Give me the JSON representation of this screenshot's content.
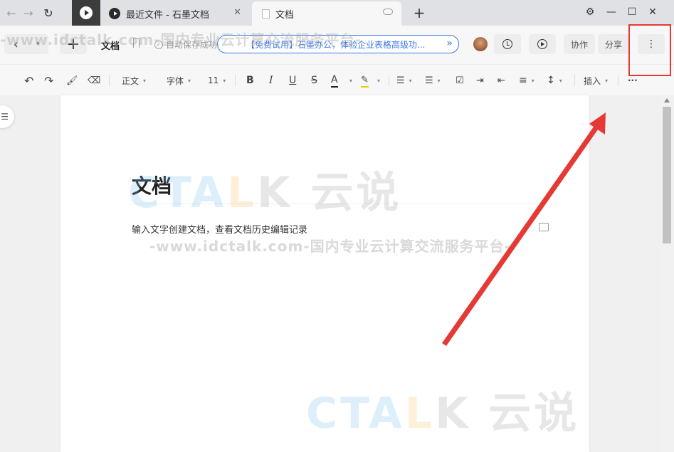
{
  "tabs": [
    {
      "label": "最近文件 - 石墨文档",
      "close": "✕"
    },
    {
      "label": "文档"
    }
  ],
  "window": {
    "settings_icon": "⚙",
    "minimize": "—",
    "maximize": "☐",
    "close": "✕",
    "new_tab": "+"
  },
  "toolbar": {
    "back": "‹",
    "back_menu": "▾",
    "new": "+",
    "doc_title": "文档",
    "autosave": "自动保存成功",
    "promo": "【免费试用】石墨办公，体验企业表格高级功...",
    "promo_arrow": "»",
    "collab": "协作",
    "share": "分享",
    "more": "⋮"
  },
  "format": {
    "undo": "↶",
    "redo": "↷",
    "paint": "🖌",
    "eraser": "⌫",
    "style": "正文",
    "font": "字体",
    "size": "11",
    "bold": "B",
    "italic": "I",
    "underline": "U",
    "strike": "S",
    "font_color": "A",
    "highlight": "✎",
    "ordered_list": "☰",
    "bullet_list": "☰",
    "checklist": "☑",
    "indent": "⇥",
    "outdent": "⇤",
    "align": "≡",
    "line_height": "↕",
    "insert": "插入",
    "overflow": "···"
  },
  "page": {
    "heading": "文档",
    "body": "输入文字创建文档，查看文档历史编辑记录",
    "outline": "☰"
  },
  "watermark": {
    "url": "-www.idctalk.com-国内专业云计算交流服务平台-",
    "logo_a": "CTA",
    "logo_b": "L",
    "logo_c": "K 云说"
  },
  "colors": {
    "accent": "#3b78e7",
    "highlight": "#e53935"
  }
}
